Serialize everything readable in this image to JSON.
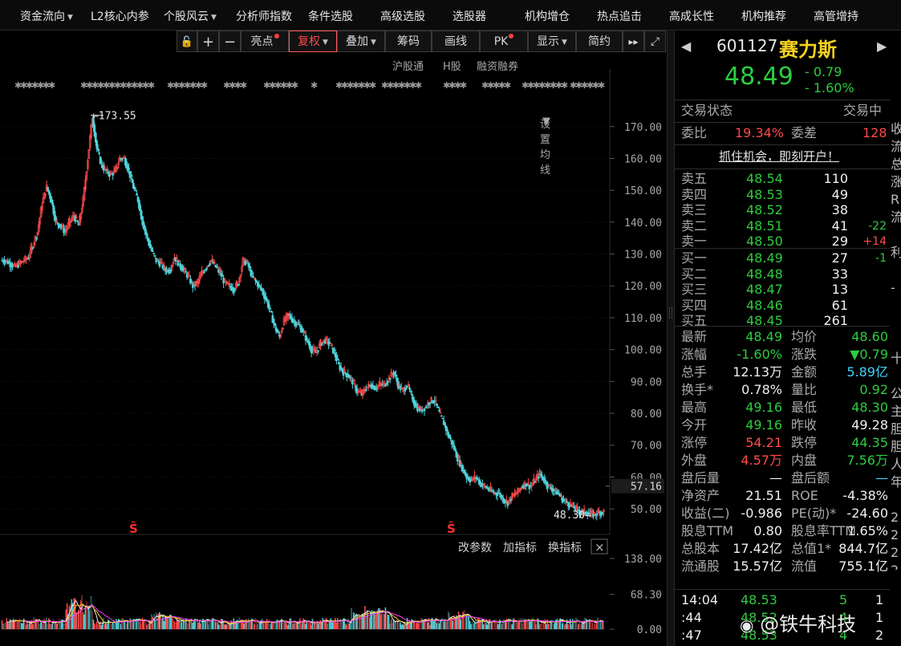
{
  "nav": {
    "items": [
      {
        "label": "资金流向",
        "caret": true
      },
      {
        "label": "L2核心内参",
        "caret": false
      },
      {
        "label": "个股风云",
        "caret": true
      },
      {
        "label": "分析师指数",
        "caret": false
      },
      {
        "label": "条件选股",
        "caret": false
      },
      {
        "label": "高级选股",
        "caret": false
      },
      {
        "label": "选股器",
        "caret": false
      },
      {
        "label": "机构增仓",
        "caret": false
      },
      {
        "label": "热点追击",
        "caret": false
      },
      {
        "label": "高成长性",
        "caret": false
      },
      {
        "label": "机构推荐",
        "caret": false
      },
      {
        "label": "高管增持",
        "caret": false
      }
    ]
  },
  "toolbar": {
    "lock": "🔓",
    "plus": "+",
    "minus": "−",
    "liangdian": "亮点",
    "fuquan": "复权",
    "diejia": "叠加",
    "chouma": "筹码",
    "huaxian": "画线",
    "pk": "PK",
    "xianshi": "显示",
    "jianyue": "简约",
    "fastforward": "▸▸",
    "fullscreen": "⤢"
  },
  "sublinks": {
    "hgt": "沪股通",
    "hshare": "H股",
    "margin": "融资融券",
    "ma_settings": "设置均线"
  },
  "chart_data": [
    {
      "type": "candlestick",
      "title": "",
      "y_ticks": [
        "170.00",
        "160.00",
        "150.00",
        "140.00",
        "130.00",
        "120.00",
        "110.00",
        "100.00",
        "90.00",
        "80.00",
        "70.00",
        "60.00",
        "50.00"
      ],
      "ylim": [
        46,
        178
      ],
      "current_price_tag": "57.16",
      "annotations": {
        "high": "173.55",
        "low": "48.30"
      },
      "price_path": [
        128,
        127,
        126,
        127,
        128,
        129,
        133,
        137,
        146,
        151,
        147,
        140,
        139,
        137,
        140,
        142,
        139,
        147,
        160,
        173,
        163,
        158,
        156,
        155,
        156,
        160,
        160,
        156,
        151,
        147,
        140,
        135,
        131,
        128,
        127,
        125,
        125,
        129,
        127,
        125,
        123,
        120,
        121,
        124,
        126,
        128,
        126,
        124,
        121,
        120,
        119,
        121,
        128,
        127,
        123,
        121,
        119,
        116,
        112,
        107,
        104,
        109,
        111,
        109,
        108,
        106,
        103,
        100,
        99,
        102,
        103,
        102,
        99,
        95,
        93,
        92,
        90,
        87,
        86,
        88,
        89,
        88,
        89,
        89,
        91,
        93,
        89,
        87,
        89,
        85,
        82,
        81,
        82,
        84,
        84,
        80,
        77,
        73,
        70,
        66,
        63,
        60,
        59,
        60,
        58,
        57,
        56,
        55,
        55,
        53,
        52,
        54,
        55,
        57,
        58,
        57,
        59,
        61,
        59,
        57,
        56,
        55,
        53,
        52,
        51,
        50,
        49,
        49,
        48.5,
        48.3,
        49,
        49
      ]
    },
    {
      "type": "bar",
      "title": "",
      "y_ticks": [
        "138.00",
        "68.30",
        "0.00"
      ],
      "ylim": [
        0,
        138
      ],
      "panel_buttons": {
        "change_params": "改参数",
        "add_indicator": "加指标",
        "swap_indicator": "换指标",
        "close": "×"
      }
    }
  ],
  "quote": {
    "code": "601127",
    "name": "赛力斯",
    "price": "48.49",
    "change": "- 0.79",
    "change_pct": "- 1.60%",
    "status_label": "交易状态",
    "status_value": "交易中",
    "weibi_label": "委比",
    "weibi_value": "19.34%",
    "weicha_label": "委差",
    "weicha_value": "128",
    "open_account": "抓住机会，即刻开户！"
  },
  "orderbook": {
    "asks": [
      {
        "label": "卖五",
        "price": "48.54",
        "vol": "110",
        "delta": ""
      },
      {
        "label": "卖四",
        "price": "48.53",
        "vol": "49",
        "delta": ""
      },
      {
        "label": "卖三",
        "price": "48.52",
        "vol": "38",
        "delta": ""
      },
      {
        "label": "卖二",
        "price": "48.51",
        "vol": "41",
        "delta": "-22"
      },
      {
        "label": "卖一",
        "price": "48.50",
        "vol": "29",
        "delta": "+14"
      }
    ],
    "bids": [
      {
        "label": "买一",
        "price": "48.49",
        "vol": "27",
        "delta": "-1"
      },
      {
        "label": "买二",
        "price": "48.48",
        "vol": "33",
        "delta": ""
      },
      {
        "label": "买三",
        "price": "48.47",
        "vol": "13",
        "delta": ""
      },
      {
        "label": "买四",
        "price": "48.46",
        "vol": "61",
        "delta": ""
      },
      {
        "label": "买五",
        "price": "48.45",
        "vol": "261",
        "delta": ""
      }
    ]
  },
  "stats": [
    {
      "l1": "最新",
      "v1": "48.49",
      "c1": "green",
      "l2": "均价",
      "v2": "48.60",
      "c2": "green"
    },
    {
      "l1": "涨幅",
      "v1": "-1.60%",
      "c1": "green",
      "l2": "涨跌",
      "v2": "▼0.79",
      "c2": "green"
    },
    {
      "l1": "总手",
      "v1": "12.13万",
      "c1": "white",
      "l2": "金额",
      "v2": "5.89亿",
      "c2": "cyan"
    },
    {
      "l1": "换手*",
      "v1": "0.78%",
      "c1": "white",
      "l2": "量比",
      "v2": "0.92",
      "c2": "green"
    },
    {
      "l1": "最高",
      "v1": "49.16",
      "c1": "green",
      "l2": "最低",
      "v2": "48.30",
      "c2": "green"
    },
    {
      "l1": "今开",
      "v1": "49.16",
      "c1": "green",
      "l2": "昨收",
      "v2": "49.28",
      "c2": "white"
    },
    {
      "l1": "涨停",
      "v1": "54.21",
      "c1": "red",
      "l2": "跌停",
      "v2": "44.35",
      "c2": "green"
    },
    {
      "l1": "外盘",
      "v1": "4.57万",
      "c1": "red",
      "l2": "内盘",
      "v2": "7.56万",
      "c2": "green"
    },
    {
      "l1": "盘后量",
      "v1": "—",
      "c1": "white",
      "l2": "盘后额",
      "v2": "—",
      "c2": "cyan"
    },
    {
      "l1": "净资产",
      "v1": "21.51",
      "c1": "white",
      "l2": "ROE",
      "v2": "-4.38%",
      "c2": "white"
    },
    {
      "l1": "收益(二)",
      "v1": "-0.986",
      "c1": "white",
      "l2": "PE(动)*",
      "v2": "-24.60",
      "c2": "white"
    },
    {
      "l1": "股息TTM",
      "v1": "0.80",
      "c1": "white",
      "l2": "股息率TTM",
      "v2": "1.65%",
      "c2": "white"
    },
    {
      "l1": "总股本",
      "v1": "17.42亿",
      "c1": "white",
      "l2": "总值1*",
      "v2": "844.7亿",
      "c2": "white"
    },
    {
      "l1": "流通股",
      "v1": "15.57亿",
      "c1": "white",
      "l2": "流值",
      "v2": "755.1亿",
      "c2": "white"
    }
  ],
  "ticks": [
    {
      "time": "14:04",
      "price": "48.53",
      "vol": "5",
      "n": "1"
    },
    {
      "time": ":44",
      "price": "48.52",
      "vol": "4",
      "n": "1"
    },
    {
      "time": ":47",
      "price": "48.53",
      "vol": "4",
      "n": "2"
    }
  ],
  "watermark": "@铁牛科技",
  "colors": {
    "up": "#ff4a4a",
    "down": "#2ecc40",
    "candle_down": "#4fd1d9",
    "price_yellow": "#f5d31c"
  }
}
